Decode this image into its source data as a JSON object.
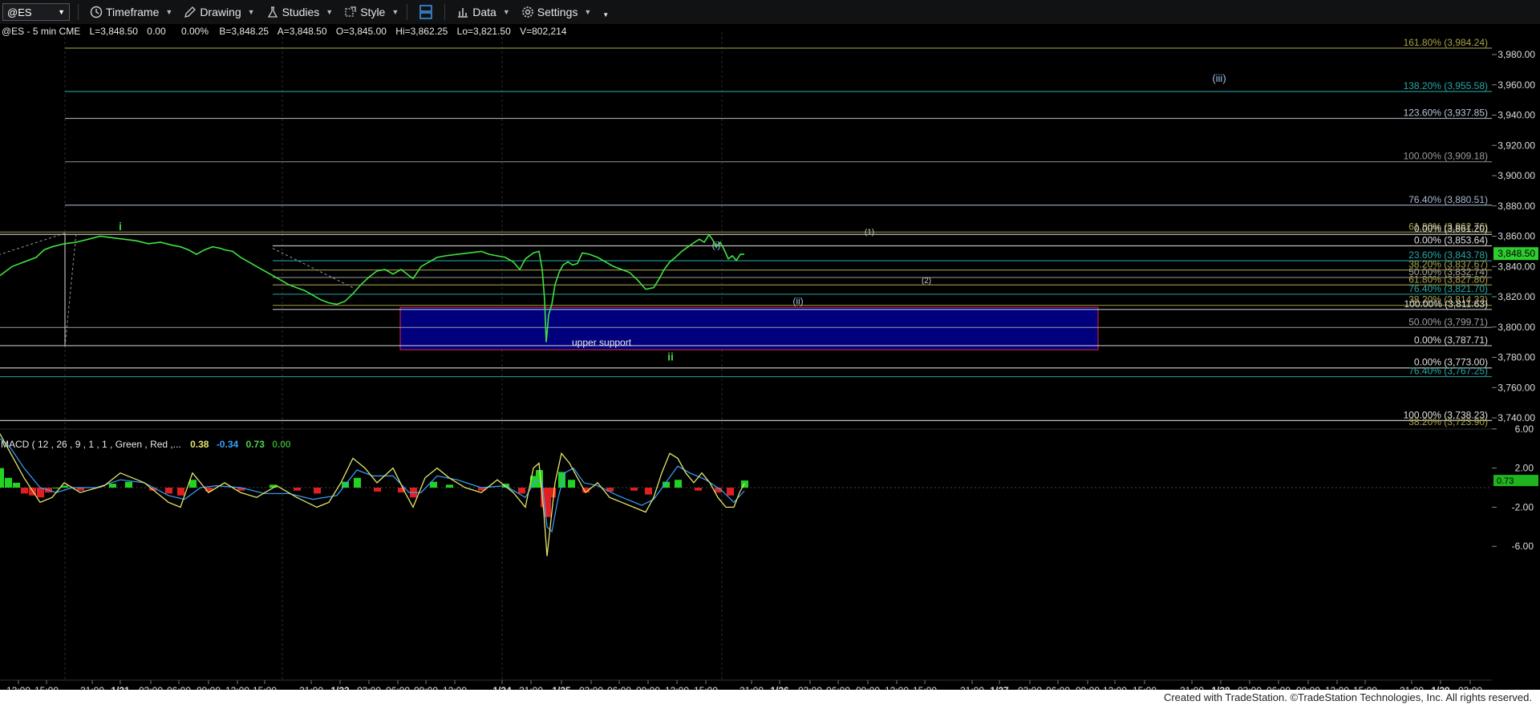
{
  "toolbar": {
    "symbol": "@ES",
    "timeframe": "Timeframe",
    "drawing": "Drawing",
    "studies": "Studies",
    "style": "Style",
    "data": "Data",
    "settings": "Settings"
  },
  "header": {
    "symbol_info": "@ES - 5 min  CME",
    "last": "L=3,848.50",
    "change": "0.00",
    "pct": "0.00%",
    "bid": "B=3,848.25",
    "ask": "A=3,848.50",
    "open": "O=3,845.00",
    "high": "Hi=3,862.25",
    "low": "Lo=3,821.50",
    "volume": "V=802,214"
  },
  "macd": {
    "label": "MACD ( 12 , 26 , 9 , 1 , 1 , Green , Red ,...",
    "v1": "0.38",
    "v2": "-0.34",
    "v3": "0.73",
    "v4": "0.00",
    "last_tag": "0.73",
    "y_ticks": [
      "6.00",
      "2.00",
      "-2.00",
      "-6.00"
    ],
    "colors": {
      "v1": "#e5e56a",
      "v2": "#3aa0ff",
      "v3": "#4cd34c",
      "v4": "#2e9e2e"
    }
  },
  "footer": {
    "credit": "Created with TradeStation. ©TradeStation Technologies, Inc. All rights reserved."
  },
  "chart_data": {
    "type": "line",
    "title": "",
    "price_ylim": [
      3730,
      3995
    ],
    "y_ticks": [
      {
        "v": 3980,
        "label": "3,980.00"
      },
      {
        "v": 3960,
        "label": "3,960.00"
      },
      {
        "v": 3940,
        "label": "3,940.00"
      },
      {
        "v": 3920,
        "label": "3,920.00"
      },
      {
        "v": 3900,
        "label": "3,900.00"
      },
      {
        "v": 3880,
        "label": "3,880.00"
      },
      {
        "v": 3860,
        "label": "3,860.00"
      },
      {
        "v": 3840,
        "label": "3,840.00"
      },
      {
        "v": 3820,
        "label": "3,820.00"
      },
      {
        "v": 3800,
        "label": "3,800.00"
      },
      {
        "v": 3780,
        "label": "3,780.00"
      },
      {
        "v": 3760,
        "label": "3,760.00"
      },
      {
        "v": 3740,
        "label": "3,740.00"
      }
    ],
    "last_price_tag": "3,848.50",
    "x_ticks": [
      "12:00",
      "15:00",
      "21:00",
      "1/21",
      "03:00",
      "06:00",
      "09:00",
      "12:00",
      "15:00",
      "21:00",
      "1/22",
      "03:00",
      "06:00",
      "09:00",
      "12:00",
      "1/24",
      "21:00",
      "1/25",
      "03:00",
      "06:00",
      "09:00",
      "12:00",
      "15:00",
      "21:00",
      "1/26",
      "03:00",
      "06:00",
      "09:00",
      "12:00",
      "15:00",
      "21:00",
      "1/27",
      "03:00",
      "06:00",
      "09:00",
      "12:00",
      "15:00",
      "21:00",
      "1/28",
      "03:00",
      "06:00",
      "09:00",
      "12:00",
      "15:00",
      "21:00",
      "1/29",
      "03:00"
    ],
    "price_series": [
      [
        0,
        3834
      ],
      [
        15,
        3840
      ],
      [
        30,
        3843
      ],
      [
        45,
        3846
      ],
      [
        55,
        3851
      ],
      [
        65,
        3853
      ],
      [
        80,
        3855
      ],
      [
        95,
        3856
      ],
      [
        110,
        3858
      ],
      [
        125,
        3860
      ],
      [
        140,
        3859
      ],
      [
        155,
        3858
      ],
      [
        170,
        3857
      ],
      [
        185,
        3855
      ],
      [
        200,
        3856
      ],
      [
        215,
        3854
      ],
      [
        225,
        3853
      ],
      [
        235,
        3851
      ],
      [
        245,
        3848
      ],
      [
        255,
        3851
      ],
      [
        265,
        3853
      ],
      [
        275,
        3852
      ],
      [
        280,
        3851
      ],
      [
        290,
        3850
      ],
      [
        300,
        3846
      ],
      [
        310,
        3843
      ],
      [
        320,
        3840
      ],
      [
        330,
        3837
      ],
      [
        340,
        3834
      ],
      [
        350,
        3831
      ],
      [
        360,
        3828
      ],
      [
        370,
        3826
      ],
      [
        380,
        3824
      ],
      [
        390,
        3821
      ],
      [
        400,
        3818
      ],
      [
        410,
        3816
      ],
      [
        420,
        3815
      ],
      [
        430,
        3817
      ],
      [
        440,
        3822
      ],
      [
        450,
        3828
      ],
      [
        460,
        3833
      ],
      [
        470,
        3837
      ],
      [
        480,
        3838
      ],
      [
        490,
        3835
      ],
      [
        500,
        3838
      ],
      [
        510,
        3834
      ],
      [
        515,
        3832
      ],
      [
        525,
        3840
      ],
      [
        535,
        3843
      ],
      [
        545,
        3846
      ],
      [
        555,
        3847
      ],
      [
        570,
        3848
      ],
      [
        585,
        3849
      ],
      [
        600,
        3850
      ],
      [
        610,
        3848
      ],
      [
        620,
        3847
      ],
      [
        630,
        3846
      ],
      [
        640,
        3843
      ],
      [
        648,
        3838
      ],
      [
        655,
        3845
      ],
      [
        665,
        3849
      ],
      [
        672,
        3850
      ],
      [
        676,
        3838
      ],
      [
        679,
        3818
      ],
      [
        681,
        3790
      ],
      [
        684,
        3808
      ],
      [
        688,
        3815
      ],
      [
        692,
        3828
      ],
      [
        697,
        3836
      ],
      [
        702,
        3841
      ],
      [
        708,
        3843
      ],
      [
        714,
        3841
      ],
      [
        720,
        3842
      ],
      [
        726,
        3849
      ],
      [
        735,
        3848
      ],
      [
        745,
        3846
      ],
      [
        755,
        3843
      ],
      [
        765,
        3840
      ],
      [
        775,
        3838
      ],
      [
        785,
        3836
      ],
      [
        795,
        3831
      ],
      [
        805,
        3825
      ],
      [
        815,
        3826
      ],
      [
        822,
        3832
      ],
      [
        828,
        3838
      ],
      [
        835,
        3843
      ],
      [
        842,
        3846
      ],
      [
        850,
        3850
      ],
      [
        858,
        3853
      ],
      [
        866,
        3856
      ],
      [
        872,
        3858
      ],
      [
        878,
        3856
      ],
      [
        884,
        3861
      ],
      [
        888,
        3858
      ],
      [
        893,
        3853
      ],
      [
        898,
        3856
      ],
      [
        903,
        3851
      ],
      [
        908,
        3845
      ],
      [
        913,
        3847
      ],
      [
        918,
        3844
      ],
      [
        923,
        3848
      ],
      [
        928,
        3848
      ]
    ],
    "macd_ylim": [
      -8,
      8
    ],
    "macd_line": [
      [
        0,
        5.5
      ],
      [
        10,
        4
      ],
      [
        30,
        1
      ],
      [
        50,
        -1.5
      ],
      [
        65,
        -1
      ],
      [
        80,
        0.5
      ],
      [
        100,
        -0.5
      ],
      [
        130,
        0.2
      ],
      [
        150,
        1.5
      ],
      [
        180,
        0.5
      ],
      [
        210,
        -1.5
      ],
      [
        225,
        -2
      ],
      [
        240,
        1.5
      ],
      [
        260,
        -0.5
      ],
      [
        280,
        0.5
      ],
      [
        300,
        -0.5
      ],
      [
        320,
        -1
      ],
      [
        345,
        0.2
      ],
      [
        370,
        -1
      ],
      [
        395,
        -2
      ],
      [
        410,
        -1.5
      ],
      [
        425,
        0.5
      ],
      [
        440,
        3
      ],
      [
        455,
        2
      ],
      [
        470,
        0.5
      ],
      [
        490,
        2
      ],
      [
        505,
        -0.5
      ],
      [
        515,
        -2
      ],
      [
        530,
        1
      ],
      [
        545,
        2
      ],
      [
        560,
        1
      ],
      [
        580,
        0
      ],
      [
        600,
        -0.5
      ],
      [
        620,
        0.8
      ],
      [
        640,
        -0.5
      ],
      [
        655,
        -2
      ],
      [
        665,
        2
      ],
      [
        672,
        2.5
      ],
      [
        678,
        -2.5
      ],
      [
        682,
        -7
      ],
      [
        686,
        -4
      ],
      [
        692,
        0.5
      ],
      [
        700,
        3.5
      ],
      [
        710,
        2.5
      ],
      [
        720,
        1
      ],
      [
        730,
        -0.5
      ],
      [
        745,
        0.5
      ],
      [
        760,
        -1
      ],
      [
        775,
        -1.5
      ],
      [
        790,
        -2
      ],
      [
        805,
        -2.5
      ],
      [
        815,
        -1
      ],
      [
        825,
        1.5
      ],
      [
        835,
        3.5
      ],
      [
        845,
        3
      ],
      [
        855,
        1.5
      ],
      [
        865,
        0.5
      ],
      [
        875,
        1.5
      ],
      [
        885,
        0.5
      ],
      [
        895,
        -1
      ],
      [
        905,
        -2
      ],
      [
        915,
        -2
      ],
      [
        922,
        -0.5
      ],
      [
        928,
        0.4
      ]
    ],
    "signal_line": [
      [
        0,
        5
      ],
      [
        12,
        4.2
      ],
      [
        30,
        2
      ],
      [
        50,
        0
      ],
      [
        70,
        -0.5
      ],
      [
        90,
        0
      ],
      [
        120,
        0
      ],
      [
        150,
        0.8
      ],
      [
        180,
        0.5
      ],
      [
        210,
        -0.8
      ],
      [
        230,
        -1.2
      ],
      [
        250,
        0
      ],
      [
        270,
        0.2
      ],
      [
        300,
        0
      ],
      [
        330,
        -0.6
      ],
      [
        360,
        -0.6
      ],
      [
        390,
        -1.2
      ],
      [
        420,
        -0.8
      ],
      [
        445,
        1.8
      ],
      [
        465,
        1.2
      ],
      [
        490,
        1.2
      ],
      [
        510,
        -0.5
      ],
      [
        525,
        -0.5
      ],
      [
        545,
        1.2
      ],
      [
        570,
        0.8
      ],
      [
        600,
        0
      ],
      [
        630,
        0.2
      ],
      [
        655,
        -1
      ],
      [
        668,
        0.8
      ],
      [
        676,
        0.5
      ],
      [
        682,
        -4
      ],
      [
        688,
        -4.5
      ],
      [
        696,
        -1
      ],
      [
        704,
        1.5
      ],
      [
        715,
        2
      ],
      [
        728,
        0.5
      ],
      [
        745,
        0.2
      ],
      [
        770,
        -0.8
      ],
      [
        800,
        -1.8
      ],
      [
        815,
        -1.2
      ],
      [
        830,
        0.5
      ],
      [
        845,
        2.2
      ],
      [
        860,
        1.5
      ],
      [
        880,
        0.8
      ],
      [
        900,
        -0.3
      ],
      [
        915,
        -1.5
      ],
      [
        928,
        -0.34
      ]
    ],
    "macd_hist": [
      [
        0,
        2
      ],
      [
        10,
        1
      ],
      [
        20,
        0.5
      ],
      [
        30,
        -0.6
      ],
      [
        40,
        -0.8
      ],
      [
        50,
        -1
      ],
      [
        60,
        -0.5
      ],
      [
        70,
        0
      ],
      [
        80,
        0.2
      ],
      [
        100,
        -0.3
      ],
      [
        140,
        0.4
      ],
      [
        160,
        0.6
      ],
      [
        190,
        -0.3
      ],
      [
        210,
        -0.6
      ],
      [
        225,
        -0.8
      ],
      [
        240,
        0.8
      ],
      [
        260,
        -0.4
      ],
      [
        300,
        -0.3
      ],
      [
        340,
        0.3
      ],
      [
        370,
        -0.3
      ],
      [
        395,
        -0.6
      ],
      [
        430,
        0.6
      ],
      [
        445,
        1
      ],
      [
        470,
        -0.4
      ],
      [
        500,
        -0.5
      ],
      [
        515,
        -1
      ],
      [
        540,
        0.6
      ],
      [
        560,
        0.3
      ],
      [
        600,
        -0.3
      ],
      [
        630,
        0.4
      ],
      [
        650,
        -0.6
      ],
      [
        665,
        1.2
      ],
      [
        672,
        1.8
      ],
      [
        678,
        -2
      ],
      [
        682,
        -3
      ],
      [
        688,
        -1
      ],
      [
        700,
        1.6
      ],
      [
        712,
        0.8
      ],
      [
        730,
        -0.5
      ],
      [
        760,
        -0.4
      ],
      [
        790,
        -0.3
      ],
      [
        808,
        -0.7
      ],
      [
        830,
        0.6
      ],
      [
        845,
        0.8
      ],
      [
        870,
        -0.3
      ],
      [
        895,
        -0.5
      ],
      [
        910,
        -0.8
      ],
      [
        928,
        0.73
      ]
    ],
    "fib_levels": [
      {
        "label": "161.80% (3,984.24)",
        "v": 3984.24,
        "color": "#a9a24a"
      },
      {
        "label": "138.20% (3,955.58)",
        "v": 3955.58,
        "color": "#2aa7a7"
      },
      {
        "label": "123.60% (3,937.85)",
        "v": 3937.85,
        "color": "#b8c4d8"
      },
      {
        "label": "100.00% (3,909.18)",
        "v": 3909.18,
        "color": "#9a9a9a"
      },
      {
        "label": "76.40% (3,880.51)",
        "v": 3880.51,
        "color": "#a8b8d0"
      },
      {
        "label": "61.80% (3,862.76)",
        "v": 3862.76,
        "color": "#a9a24a"
      },
      {
        "label": "0.00% (3,861.20)",
        "v": 3861.2,
        "color": "#e0e0e0"
      },
      {
        "label": "0.00% (3,853.64)",
        "v": 3853.64,
        "color": "#e0e0e0"
      },
      {
        "label": "23.60% (3,843.78)",
        "v": 3843.78,
        "color": "#2aa7a7"
      },
      {
        "label": "38.20% (3,837.67)",
        "v": 3837.67,
        "color": "#a9a24a"
      },
      {
        "label": "50.00% (3,832.74)",
        "v": 3832.74,
        "color": "#a0a0a0"
      },
      {
        "label": "61.80% (3,827.80)",
        "v": 3827.8,
        "color": "#a9a24a"
      },
      {
        "label": "76.40% (3,821.70)",
        "v": 3821.7,
        "color": "#2aa7a7"
      },
      {
        "label": "38.20% (3,814.33)",
        "v": 3814.33,
        "color": "#a9a24a"
      },
      {
        "label": "100.00% (3,811.63)",
        "v": 3811.63,
        "color": "#e0e0e0"
      },
      {
        "label": "50.00% (3,799.71)",
        "v": 3799.71,
        "color": "#a0a0a0"
      },
      {
        "label": "0.00% (3,787.71)",
        "v": 3787.71,
        "color": "#e0e0e0"
      },
      {
        "label": "0.00% (3,773.00)",
        "v": 3773.0,
        "color": "#e0e0e0"
      },
      {
        "label": "76.40% (3,767.25)",
        "v": 3767.25,
        "color": "#2aa7a7"
      },
      {
        "label": "100.00% (3,738.23)",
        "v": 3738.23,
        "color": "#e0e0e0"
      },
      {
        "label": "38.20% (3,723.90)",
        "v": 3723.9,
        "color": "#a9a24a"
      }
    ],
    "support_zone": {
      "label": "upper support",
      "top": 3813,
      "bottom": 3785
    },
    "wave_labels": [
      {
        "text": "i",
        "x": 150,
        "v": 3864,
        "color": "#3fd13f",
        "size": 14
      },
      {
        "text": "ii",
        "x": 836,
        "v": 3778,
        "color": "#3fd13f",
        "size": 14
      },
      {
        "text": "(i)",
        "x": 893,
        "v": 3852,
        "color": "#9fc2ea",
        "size": 12
      },
      {
        "text": "(ii)",
        "x": 995,
        "v": 3815,
        "color": "#9fc2ea",
        "size": 12
      },
      {
        "text": "(1)",
        "x": 1084,
        "v": 3861,
        "color": "#cccccc",
        "size": 10
      },
      {
        "text": "(2)",
        "x": 1155,
        "v": 3829,
        "color": "#cccccc",
        "size": 10
      },
      {
        "text": "(iii)",
        "x": 1520,
        "v": 3962,
        "color": "#9fc2ea",
        "size": 13
      }
    ]
  }
}
